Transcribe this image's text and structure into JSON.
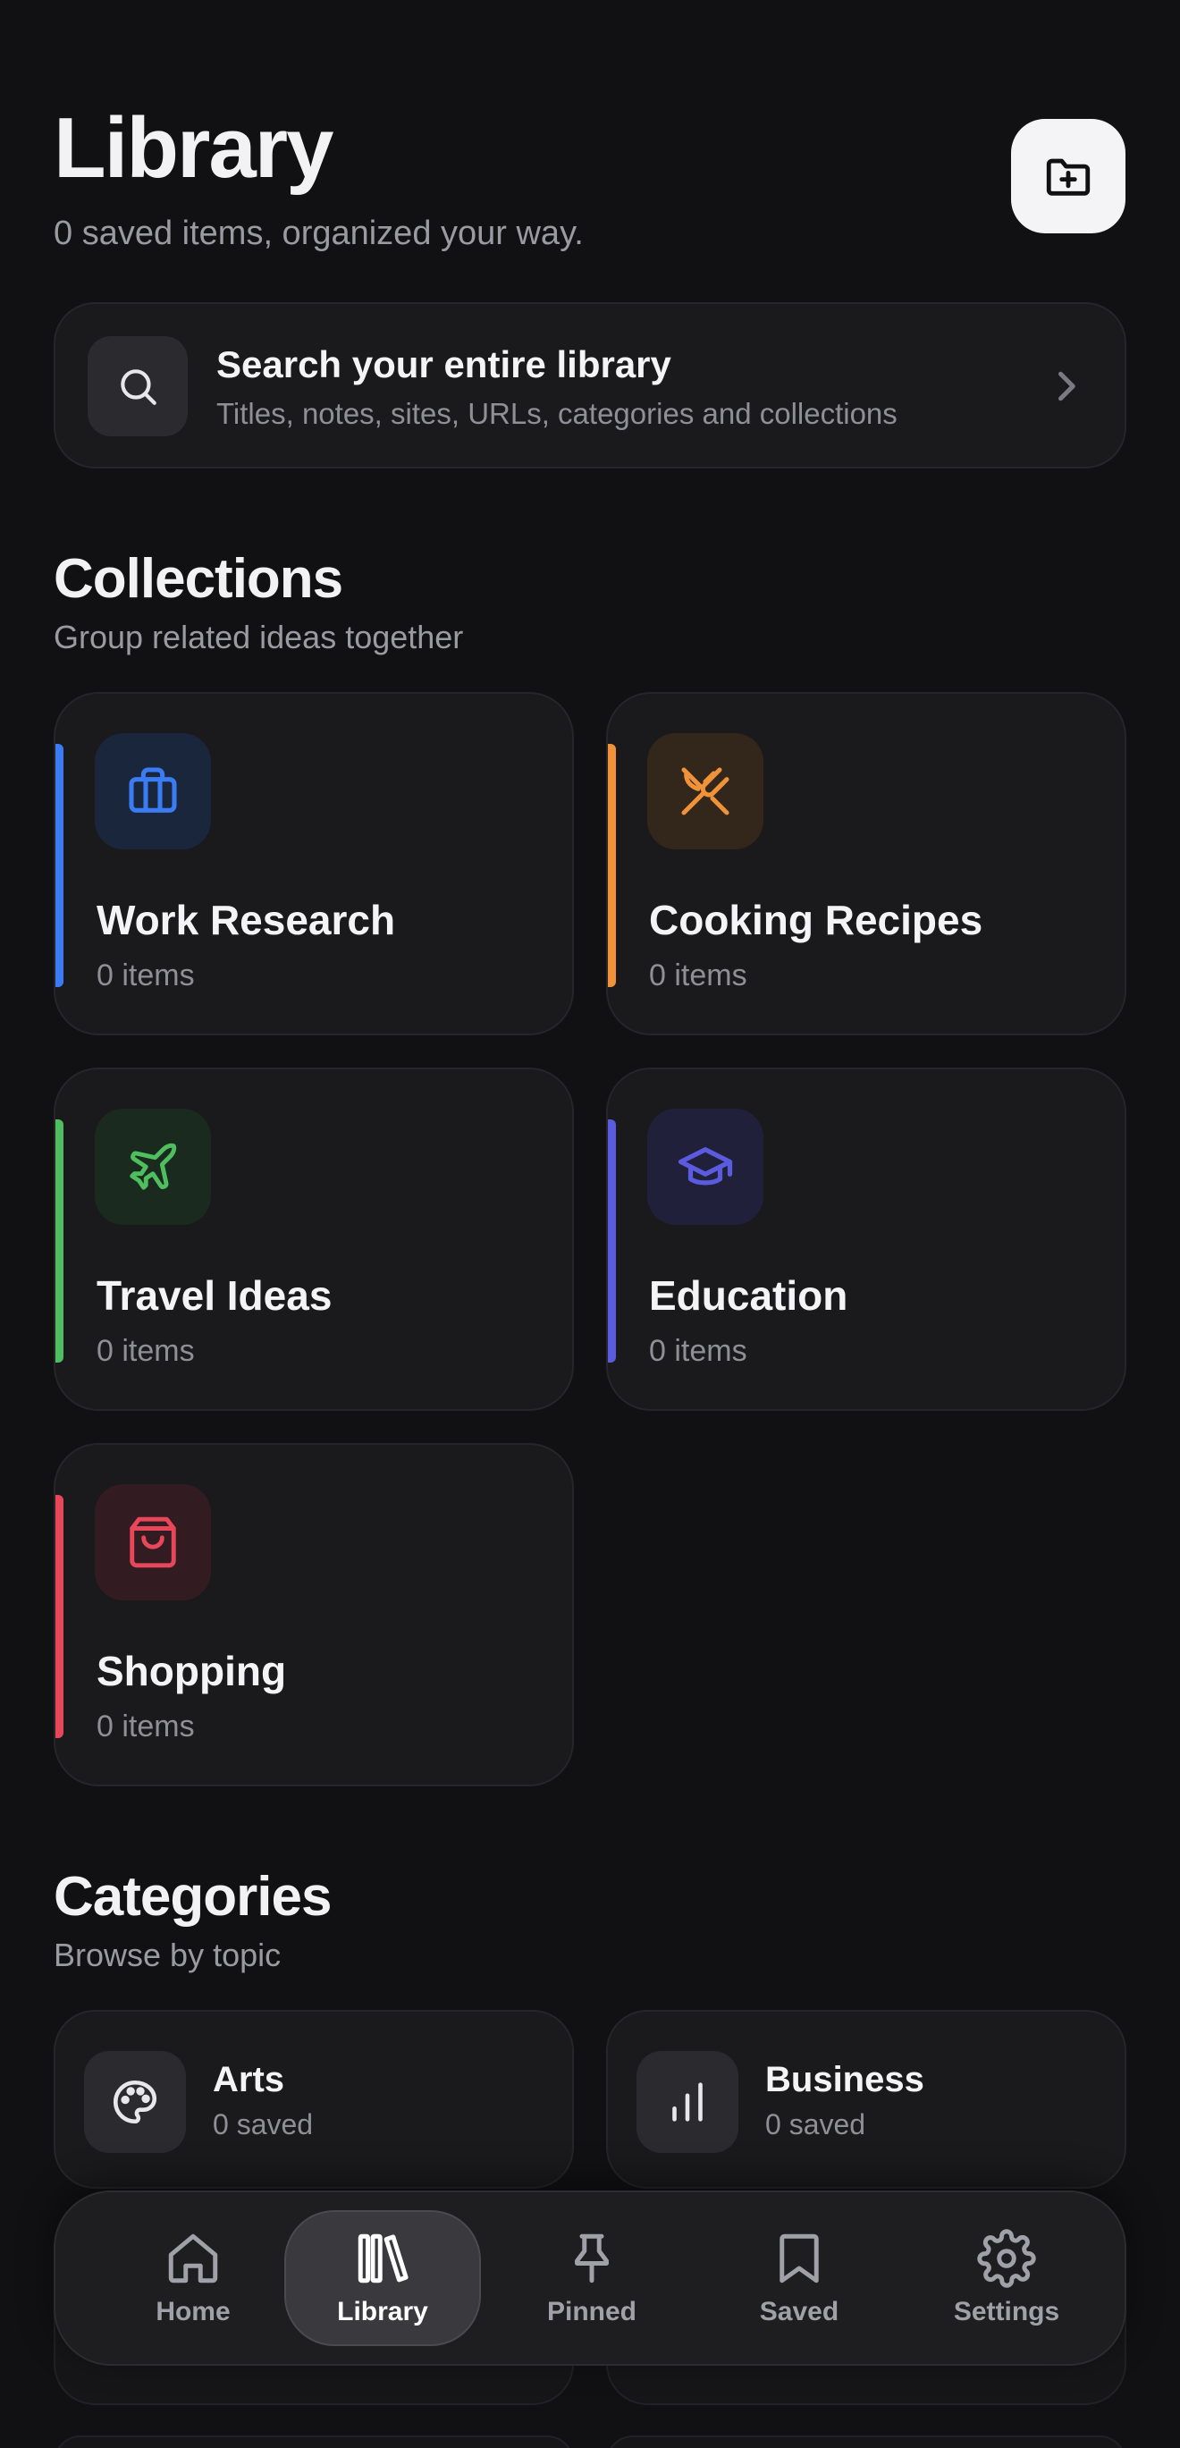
{
  "header": {
    "title": "Library",
    "subtitle": "0 saved items, organized your way.",
    "new_collection_icon": "folder-plus-icon"
  },
  "search": {
    "title": "Search your entire library",
    "subtitle": "Titles, notes, sites, URLs, categories and collections",
    "icon": "search-icon"
  },
  "collections": {
    "title": "Collections",
    "subtitle": "Group related ideas together",
    "items": [
      {
        "name": "Work Research",
        "count": "0 items",
        "icon": "briefcase-icon",
        "color": "#3b7cf5"
      },
      {
        "name": "Cooking Recipes",
        "count": "0 items",
        "icon": "utensils-crossed-icon",
        "color": "#f0923a"
      },
      {
        "name": "Travel Ideas",
        "count": "0 items",
        "icon": "plane-icon",
        "color": "#4fbe5f"
      },
      {
        "name": "Education",
        "count": "0 items",
        "icon": "graduation-cap-icon",
        "color": "#5b5be0"
      },
      {
        "name": "Shopping",
        "count": "0 items",
        "icon": "shopping-bag-icon",
        "color": "#e8475a"
      }
    ]
  },
  "categories": {
    "title": "Categories",
    "subtitle": "Browse by topic",
    "items": [
      {
        "name": "Arts",
        "count": "0 saved",
        "icon": "palette-icon"
      },
      {
        "name": "Business",
        "count": "0 saved",
        "icon": "bar-chart-icon"
      }
    ]
  },
  "nav": {
    "items": [
      {
        "label": "Home",
        "icon": "home-icon",
        "active": false
      },
      {
        "label": "Library",
        "icon": "library-icon",
        "active": true
      },
      {
        "label": "Pinned",
        "icon": "pin-icon",
        "active": false
      },
      {
        "label": "Saved",
        "icon": "bookmark-icon",
        "active": false
      },
      {
        "label": "Settings",
        "icon": "gear-icon",
        "active": false
      }
    ]
  }
}
